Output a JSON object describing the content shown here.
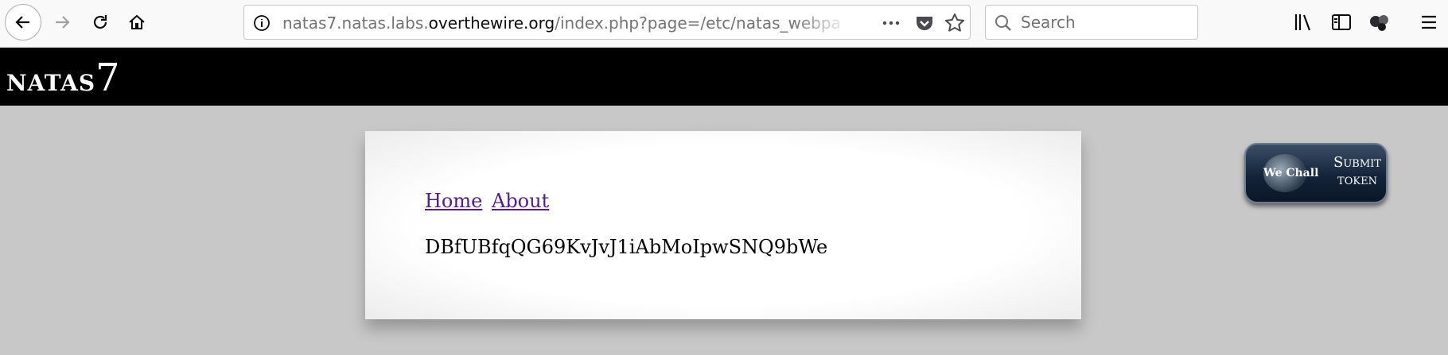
{
  "browser": {
    "url_prefix": "natas7.natas.labs.",
    "url_host": "overthewire.org",
    "url_path": "/index.php?page=/etc/natas_webpa",
    "search_placeholder": "Search",
    "icons": [
      "back-icon",
      "forward-icon",
      "reload-icon",
      "home-icon",
      "info-icon",
      "more-icon",
      "pocket-icon",
      "bookmark-star-icon",
      "search-icon",
      "library-icon",
      "sidebar-icon",
      "extension-icon",
      "menu-icon"
    ]
  },
  "header": {
    "title_letters": "natas",
    "title_number": "7"
  },
  "content": {
    "nav": [
      "Home",
      "About"
    ],
    "secret_text": "DBfUBfqQG69KvJvJ1iAbMoIpwSNQ9bWe"
  },
  "wechall": {
    "brand": "We Chall",
    "label_line1": "Submit",
    "label_line2": "token"
  },
  "colors": {
    "header_bg": "#000000",
    "page_bg": "#c8c8c8",
    "link": "#551a8b",
    "wechall_bg": "#14233a"
  }
}
